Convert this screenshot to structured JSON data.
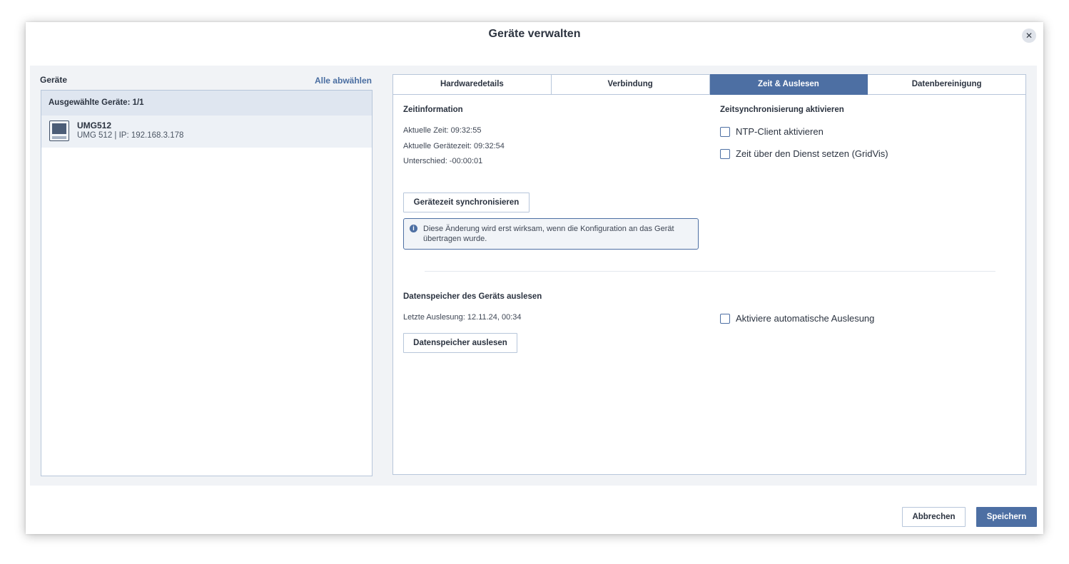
{
  "dialog": {
    "title": "Geräte verwalten",
    "close_icon": "close-icon"
  },
  "left_panel": {
    "title": "Geräte",
    "select_all_label": "Alle abwählen",
    "selected_header": "Ausgewählte Geräte: 1/1",
    "devices": [
      {
        "name": "UMG512",
        "info": "UMG 512 | IP: 192.168.3.178",
        "icon": "device-meter-icon"
      }
    ]
  },
  "tabs": [
    {
      "label": "Hardwaredetails",
      "active": false
    },
    {
      "label": "Verbindung",
      "active": false
    },
    {
      "label": "Zeit & Auslesen",
      "active": true
    },
    {
      "label": "Datenbereinigung",
      "active": false
    }
  ],
  "time_info": {
    "title": "Zeitinformation",
    "current_time": "Aktuelle Zeit: 09:32:55",
    "device_time": "Aktuelle Gerätezeit: 09:32:54",
    "difference": "Unterschied: -00:00:01",
    "sync_button": "Gerätezeit synchronisieren",
    "notice_icon": "info-icon",
    "notice_text": "Diese Änderung wird erst wirksam, wenn die Konfiguration an das Gerät übertragen wurde."
  },
  "time_sync": {
    "title": "Zeitsynchronisierung aktivieren",
    "options": [
      {
        "label": "NTP-Client aktivieren",
        "checked": false
      },
      {
        "label": "Zeit über den Dienst setzen (GridVis)",
        "checked": false
      }
    ]
  },
  "datastore": {
    "title": "Datenspeicher des Geräts auslesen",
    "last_readout": "Letzte Auslesung: 12.11.24, 00:34",
    "readout_button": "Datenspeicher auslesen",
    "auto_readout_label": "Aktiviere automatische Auslesung",
    "auto_readout_checked": false
  },
  "footer": {
    "cancel_label": "Abbrechen",
    "save_label": "Speichern"
  },
  "colors": {
    "accent": "#4d6fa3",
    "border": "#b7c6da",
    "panel_bg": "#f1f3f6"
  }
}
